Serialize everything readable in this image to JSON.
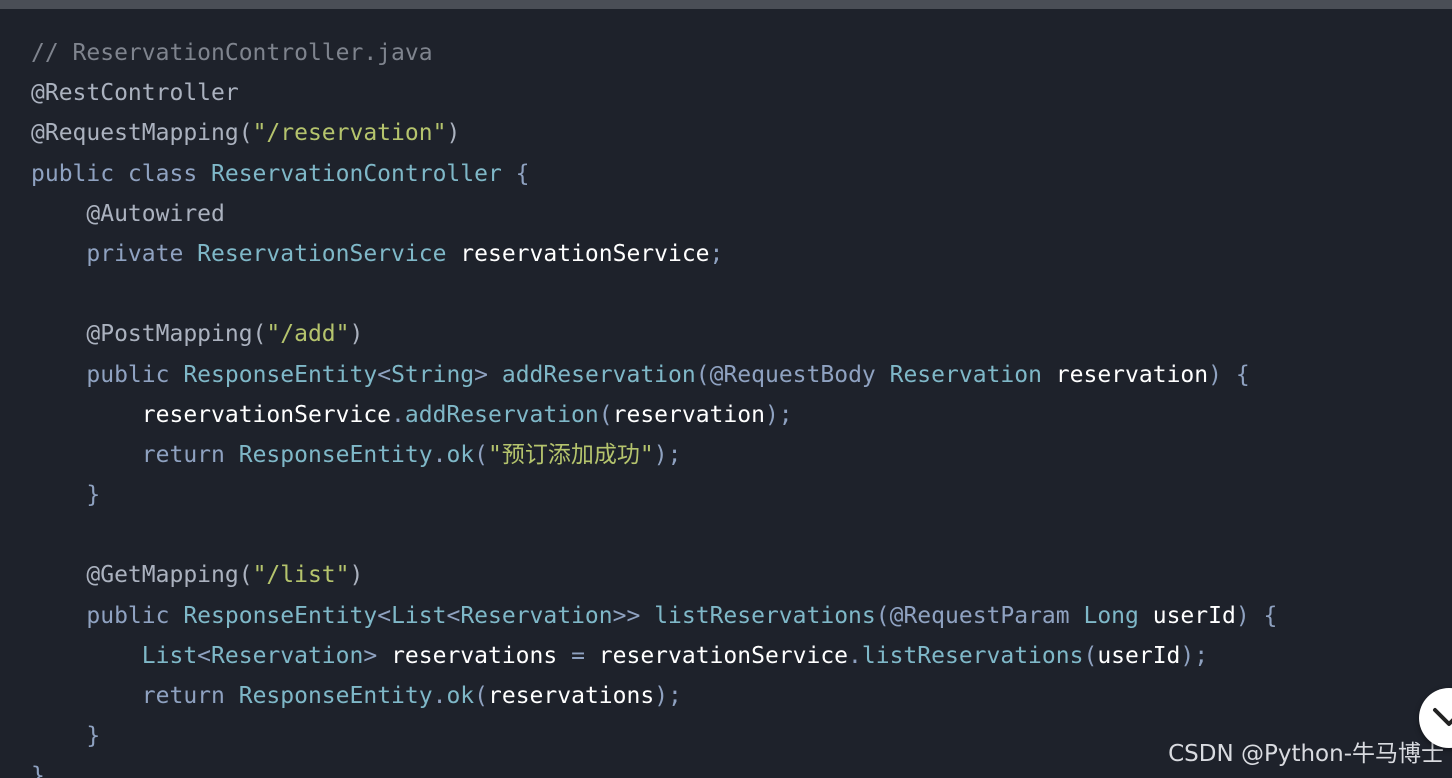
{
  "code": {
    "language": "java",
    "lines": [
      [
        {
          "t": "comment",
          "v": "// ReservationController.java"
        }
      ],
      [
        {
          "t": "annotation",
          "v": "@RestController"
        }
      ],
      [
        {
          "t": "annotation",
          "v": "@RequestMapping("
        },
        {
          "t": "string",
          "v": "\"/reservation\""
        },
        {
          "t": "annotation",
          "v": ")"
        }
      ],
      [
        {
          "t": "keyword",
          "v": "public class "
        },
        {
          "t": "type",
          "v": "ReservationController"
        },
        {
          "t": "punct",
          "v": " {"
        }
      ],
      [
        {
          "t": "plain",
          "v": "    "
        },
        {
          "t": "annotation",
          "v": "@Autowired"
        }
      ],
      [
        {
          "t": "plain",
          "v": "    "
        },
        {
          "t": "keyword",
          "v": "private "
        },
        {
          "t": "type",
          "v": "ReservationService"
        },
        {
          "t": "plain",
          "v": " "
        },
        {
          "t": "ident",
          "v": "reservationService"
        },
        {
          "t": "punct",
          "v": ";"
        }
      ],
      [],
      [
        {
          "t": "plain",
          "v": "    "
        },
        {
          "t": "annotation",
          "v": "@PostMapping("
        },
        {
          "t": "string",
          "v": "\"/add\""
        },
        {
          "t": "annotation",
          "v": ")"
        }
      ],
      [
        {
          "t": "plain",
          "v": "    "
        },
        {
          "t": "keyword",
          "v": "public "
        },
        {
          "t": "type",
          "v": "ResponseEntity"
        },
        {
          "t": "punct",
          "v": "<"
        },
        {
          "t": "type",
          "v": "String"
        },
        {
          "t": "punct",
          "v": "> "
        },
        {
          "t": "method",
          "v": "addReservation"
        },
        {
          "t": "punct",
          "v": "("
        },
        {
          "t": "keyword",
          "v": "@RequestBody "
        },
        {
          "t": "type",
          "v": "Reservation"
        },
        {
          "t": "plain",
          "v": " "
        },
        {
          "t": "ident",
          "v": "reservation"
        },
        {
          "t": "punct",
          "v": ") {"
        }
      ],
      [
        {
          "t": "plain",
          "v": "        "
        },
        {
          "t": "ident",
          "v": "reservationService"
        },
        {
          "t": "punct",
          "v": "."
        },
        {
          "t": "method",
          "v": "addReservation"
        },
        {
          "t": "punct",
          "v": "("
        },
        {
          "t": "ident",
          "v": "reservation"
        },
        {
          "t": "punct",
          "v": ");"
        }
      ],
      [
        {
          "t": "plain",
          "v": "        "
        },
        {
          "t": "keyword",
          "v": "return "
        },
        {
          "t": "type",
          "v": "ResponseEntity"
        },
        {
          "t": "punct",
          "v": "."
        },
        {
          "t": "method",
          "v": "ok"
        },
        {
          "t": "punct",
          "v": "("
        },
        {
          "t": "string",
          "v": "\"预订添加成功\""
        },
        {
          "t": "punct",
          "v": ");"
        }
      ],
      [
        {
          "t": "plain",
          "v": "    "
        },
        {
          "t": "punct",
          "v": "}"
        }
      ],
      [],
      [
        {
          "t": "plain",
          "v": "    "
        },
        {
          "t": "annotation",
          "v": "@GetMapping("
        },
        {
          "t": "string",
          "v": "\"/list\""
        },
        {
          "t": "annotation",
          "v": ")"
        }
      ],
      [
        {
          "t": "plain",
          "v": "    "
        },
        {
          "t": "keyword",
          "v": "public "
        },
        {
          "t": "type",
          "v": "ResponseEntity"
        },
        {
          "t": "punct",
          "v": "<"
        },
        {
          "t": "type",
          "v": "List"
        },
        {
          "t": "punct",
          "v": "<"
        },
        {
          "t": "type",
          "v": "Reservation"
        },
        {
          "t": "punct",
          "v": ">> "
        },
        {
          "t": "method",
          "v": "listReservations"
        },
        {
          "t": "punct",
          "v": "("
        },
        {
          "t": "keyword",
          "v": "@RequestParam "
        },
        {
          "t": "type",
          "v": "Long"
        },
        {
          "t": "plain",
          "v": " "
        },
        {
          "t": "ident",
          "v": "userId"
        },
        {
          "t": "punct",
          "v": ") {"
        }
      ],
      [
        {
          "t": "plain",
          "v": "        "
        },
        {
          "t": "type",
          "v": "List"
        },
        {
          "t": "punct",
          "v": "<"
        },
        {
          "t": "type",
          "v": "Reservation"
        },
        {
          "t": "punct",
          "v": "> "
        },
        {
          "t": "ident",
          "v": "reservations"
        },
        {
          "t": "punct",
          "v": " = "
        },
        {
          "t": "ident",
          "v": "reservationService"
        },
        {
          "t": "punct",
          "v": "."
        },
        {
          "t": "method",
          "v": "listReservations"
        },
        {
          "t": "punct",
          "v": "("
        },
        {
          "t": "ident",
          "v": "userId"
        },
        {
          "t": "punct",
          "v": ");"
        }
      ],
      [
        {
          "t": "plain",
          "v": "        "
        },
        {
          "t": "keyword",
          "v": "return "
        },
        {
          "t": "type",
          "v": "ResponseEntity"
        },
        {
          "t": "punct",
          "v": "."
        },
        {
          "t": "method",
          "v": "ok"
        },
        {
          "t": "punct",
          "v": "("
        },
        {
          "t": "ident",
          "v": "reservations"
        },
        {
          "t": "punct",
          "v": ");"
        }
      ],
      [
        {
          "t": "plain",
          "v": "    "
        },
        {
          "t": "punct",
          "v": "}"
        }
      ],
      [
        {
          "t": "punct",
          "v": "}"
        }
      ]
    ]
  },
  "watermark": "CSDN @Python-牛马博士",
  "scroll_button": {
    "icon": "chevron-down-icon"
  },
  "colors": {
    "background": "#1e222b",
    "top_bar": "#4a4e56",
    "comment": "#7f848e",
    "string": "#b5c46d",
    "keyword": "#8fa2c1",
    "type": "#7fb8c8",
    "identifier": "#ffffff"
  }
}
